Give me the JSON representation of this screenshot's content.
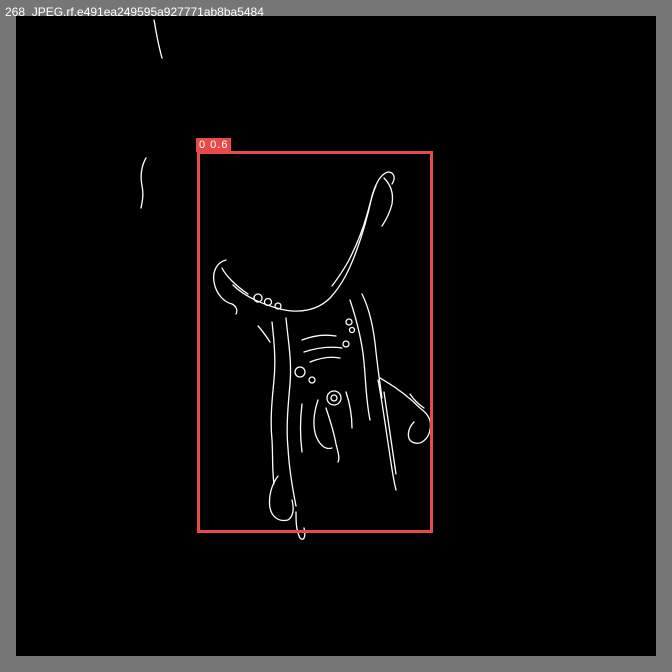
{
  "image": {
    "filename": "268_JPEG.rf.e491ea249595a927771ab8ba5484",
    "background_color": "#000000",
    "frame_color": "#767676"
  },
  "detection": {
    "label": "0 0.6",
    "box_color": "#e84a4a"
  }
}
